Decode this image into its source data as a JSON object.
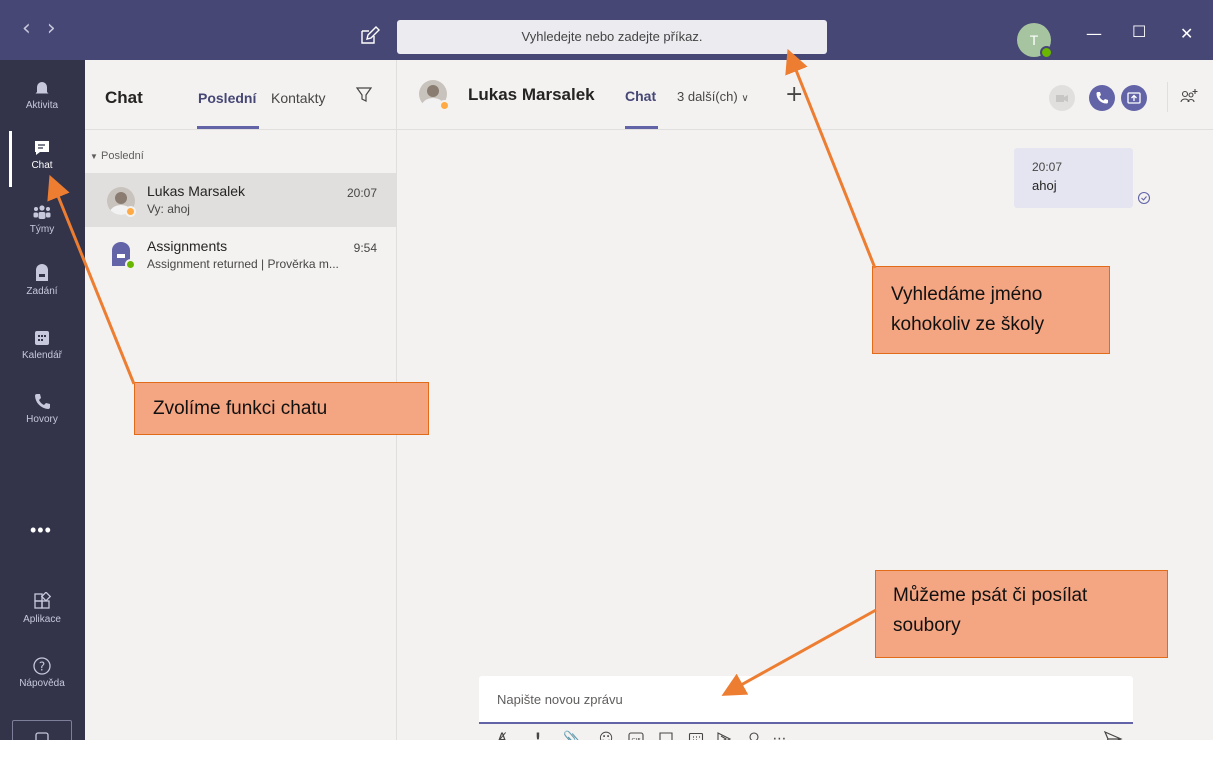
{
  "titlebar": {
    "search_placeholder": "Vyhledejte nebo zadejte příkaz.",
    "user_initial": "T"
  },
  "appbar": {
    "items": [
      {
        "label": "Aktivita",
        "icon": "bell-icon"
      },
      {
        "label": "Chat",
        "icon": "chat-icon"
      },
      {
        "label": "Týmy",
        "icon": "teams-icon"
      },
      {
        "label": "Zadání",
        "icon": "assignments-icon"
      },
      {
        "label": "Kalendář",
        "icon": "calendar-icon"
      },
      {
        "label": "Hovory",
        "icon": "phone-icon"
      },
      {
        "label": "Aplikace",
        "icon": "apps-icon"
      },
      {
        "label": "Nápověda",
        "icon": "help-icon"
      }
    ],
    "more": "•••"
  },
  "chat_list": {
    "title": "Chat",
    "tab_recent": "Poslední",
    "tab_contacts": "Kontakty",
    "section_label": "Poslední",
    "items": [
      {
        "name": "Lukas Marsalek",
        "preview": "Vy: ahoj",
        "time": "20:07",
        "presence": "away"
      },
      {
        "name": "Assignments",
        "preview": "Assignment returned | Prověrka m...",
        "time": "9:54",
        "presence": "available"
      }
    ]
  },
  "main": {
    "contact_name": "Lukas Marsalek",
    "tab_chat": "Chat",
    "tab_more": "3 další(ch)",
    "message": {
      "time": "20:07",
      "text": "ahoj"
    },
    "compose_placeholder": "Napište novou zprávu"
  },
  "callouts": {
    "search": [
      "Vyhledáme jméno",
      "kohokoliv ze školy"
    ],
    "chat": [
      "Zvolíme funkci chatu"
    ],
    "compose": [
      "Můžeme psát či posílat",
      "soubory"
    ]
  },
  "colors": {
    "titlebar": "#464775",
    "appbar": "#33344a",
    "accent": "#6264a7",
    "callout_fill": "#f4a582",
    "callout_border": "#e26b1a",
    "arrow": "#ed7d31"
  }
}
